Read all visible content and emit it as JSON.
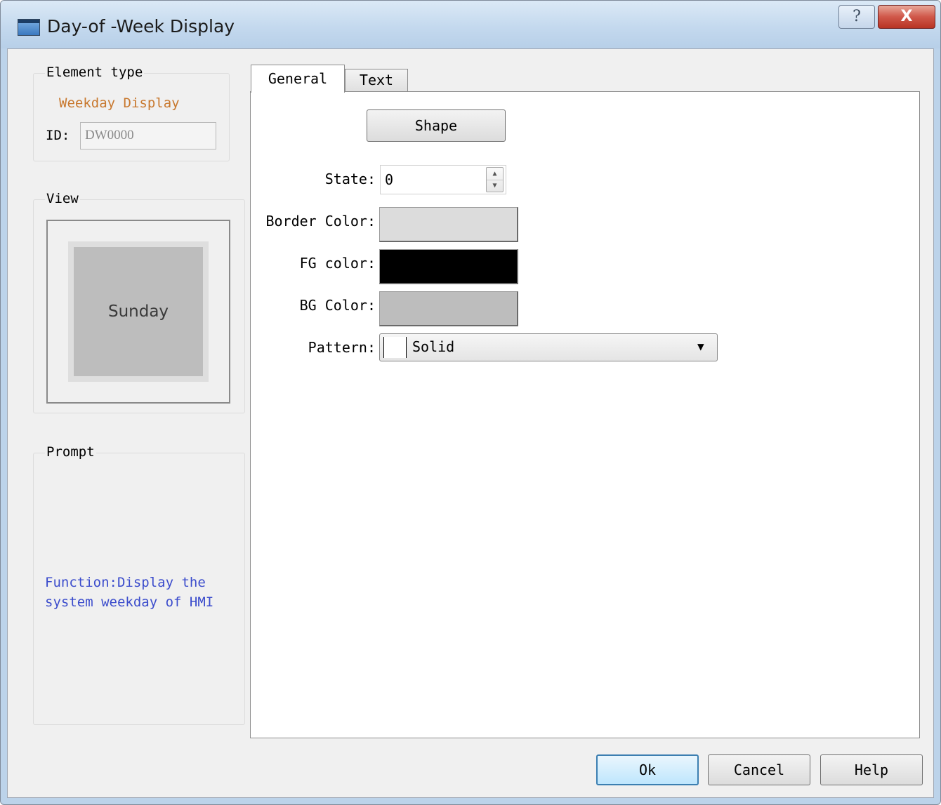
{
  "window": {
    "title": "Day-of -Week Display",
    "help_glyph": "?",
    "close_glyph": "X"
  },
  "element_type": {
    "group_label": "Element type",
    "value": "Weekday Display",
    "id_label": "ID:",
    "id_value": "DW0000"
  },
  "view": {
    "group_label": "View",
    "preview_text": "Sunday"
  },
  "prompt": {
    "group_label": "Prompt",
    "text": "Function:Display the\nsystem weekday of HMI"
  },
  "tabs": [
    {
      "label": "General",
      "active": true
    },
    {
      "label": "Text",
      "active": false
    }
  ],
  "general": {
    "shape_button": "Shape",
    "state_label": "State:",
    "state_value": "0",
    "border_color_label": "Border Color:",
    "border_color": "#dcdcdc",
    "fg_color_label": "FG color:",
    "fg_color": "#000000",
    "bg_color_label": "BG Color:",
    "bg_color": "#bdbdbd",
    "pattern_label": "Pattern:",
    "pattern_value": "Solid"
  },
  "buttons": {
    "ok": "Ok",
    "cancel": "Cancel",
    "help": "Help"
  },
  "colors": {
    "element_type_value": "#c8782e",
    "prompt_text": "#3b4ccc",
    "close_button": "#c8483a"
  }
}
